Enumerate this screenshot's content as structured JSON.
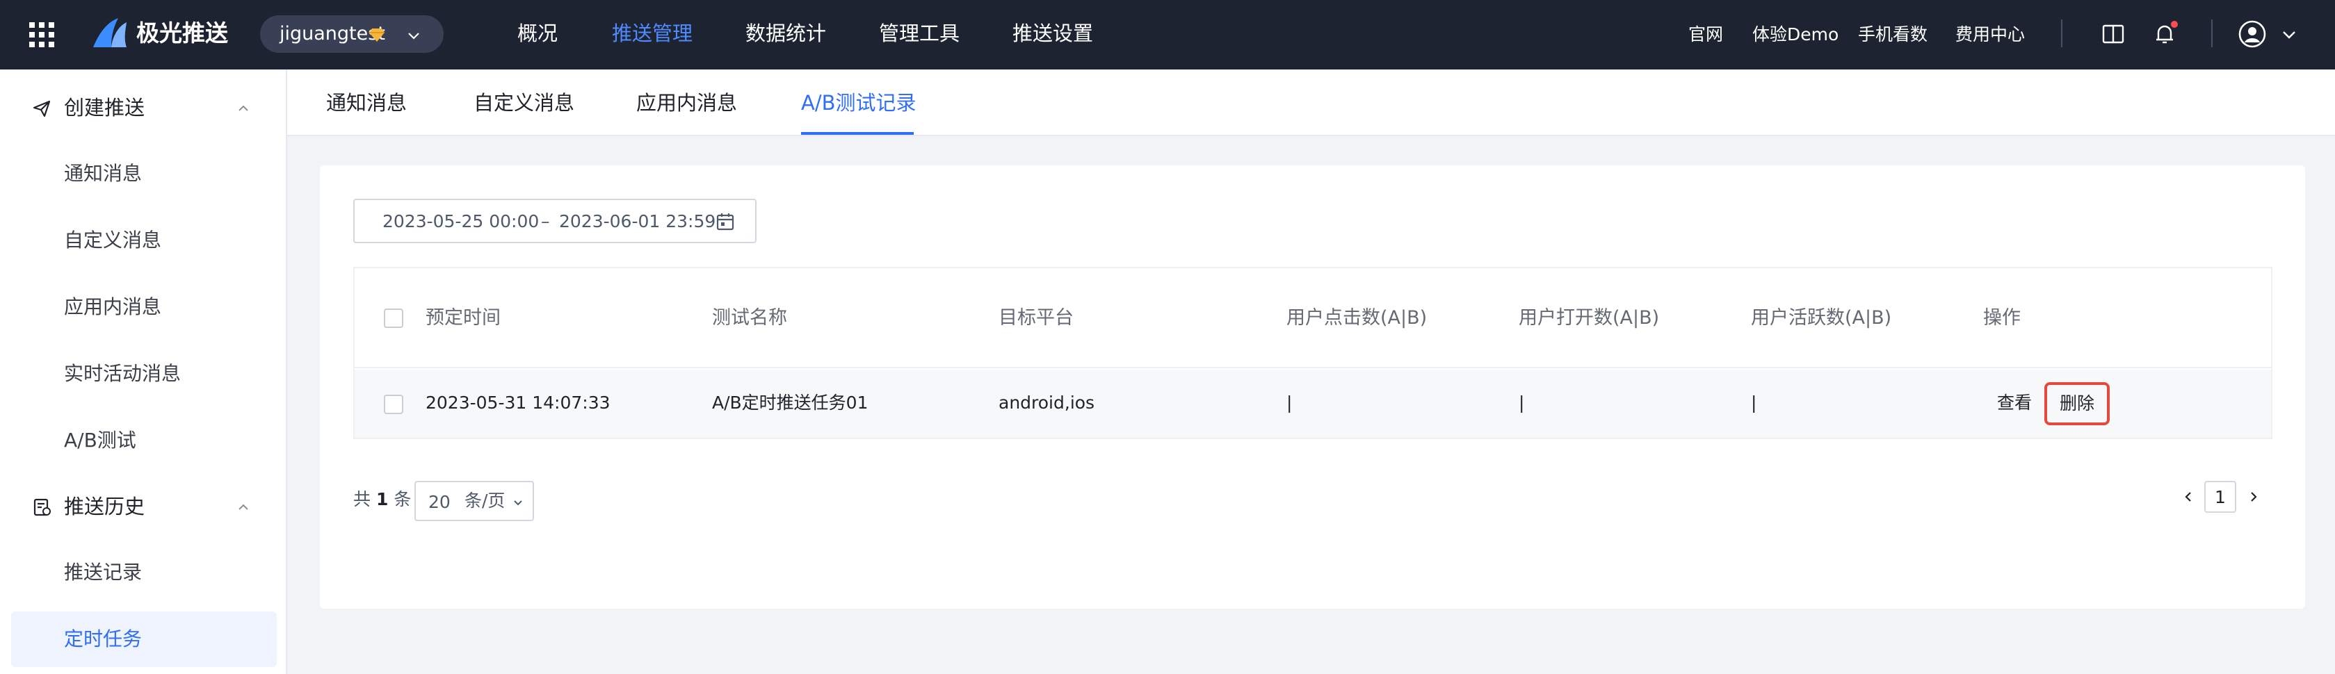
{
  "brand": {
    "name": "极光推送"
  },
  "org": {
    "name": "jiguangtest"
  },
  "topnav": [
    "概况",
    "推送管理",
    "数据统计",
    "管理工具",
    "推送设置"
  ],
  "toplinks": [
    "官网",
    "体验Demo",
    "手机看数",
    "费用中心"
  ],
  "sidebar": {
    "groups": [
      {
        "label": "创建推送",
        "icon": "paper-plane-icon",
        "items": [
          "通知消息",
          "自定义消息",
          "应用内消息",
          "实时活动消息",
          "A/B测试"
        ]
      },
      {
        "label": "推送历史",
        "icon": "history-icon",
        "items": [
          "推送记录",
          "定时任务"
        ]
      }
    ],
    "active_item": "定时任务"
  },
  "tabs": [
    "通知消息",
    "自定义消息",
    "应用内消息",
    "A/B测试记录"
  ],
  "active_tab": "A/B测试记录",
  "filter": {
    "date_start": "2023-05-25 00:00",
    "date_sep": "–",
    "date_end": "2023-06-01 23:59"
  },
  "table": {
    "headers": [
      "预定时间",
      "测试名称",
      "目标平台",
      "用户点击数(A|B)",
      "用户打开数(A|B)",
      "用户活跃数(A|B)",
      "操作"
    ],
    "rows": [
      {
        "time": "2023-05-31 14:07:33",
        "name": "A/B定时推送任务01",
        "platform": "android,ios",
        "clicks": "|",
        "opens": "|",
        "active": "|",
        "action_view": "查看",
        "action_delete": "删除"
      }
    ]
  },
  "pagination": {
    "total_prefix": "共",
    "total": "1",
    "total_suffix": "条",
    "page_size": "20",
    "page_size_unit": "条/页",
    "current_page": "1"
  },
  "colors": {
    "topbar": "#1e2332",
    "accent": "#2f6ef5",
    "highlight_border": "#e5483c"
  }
}
